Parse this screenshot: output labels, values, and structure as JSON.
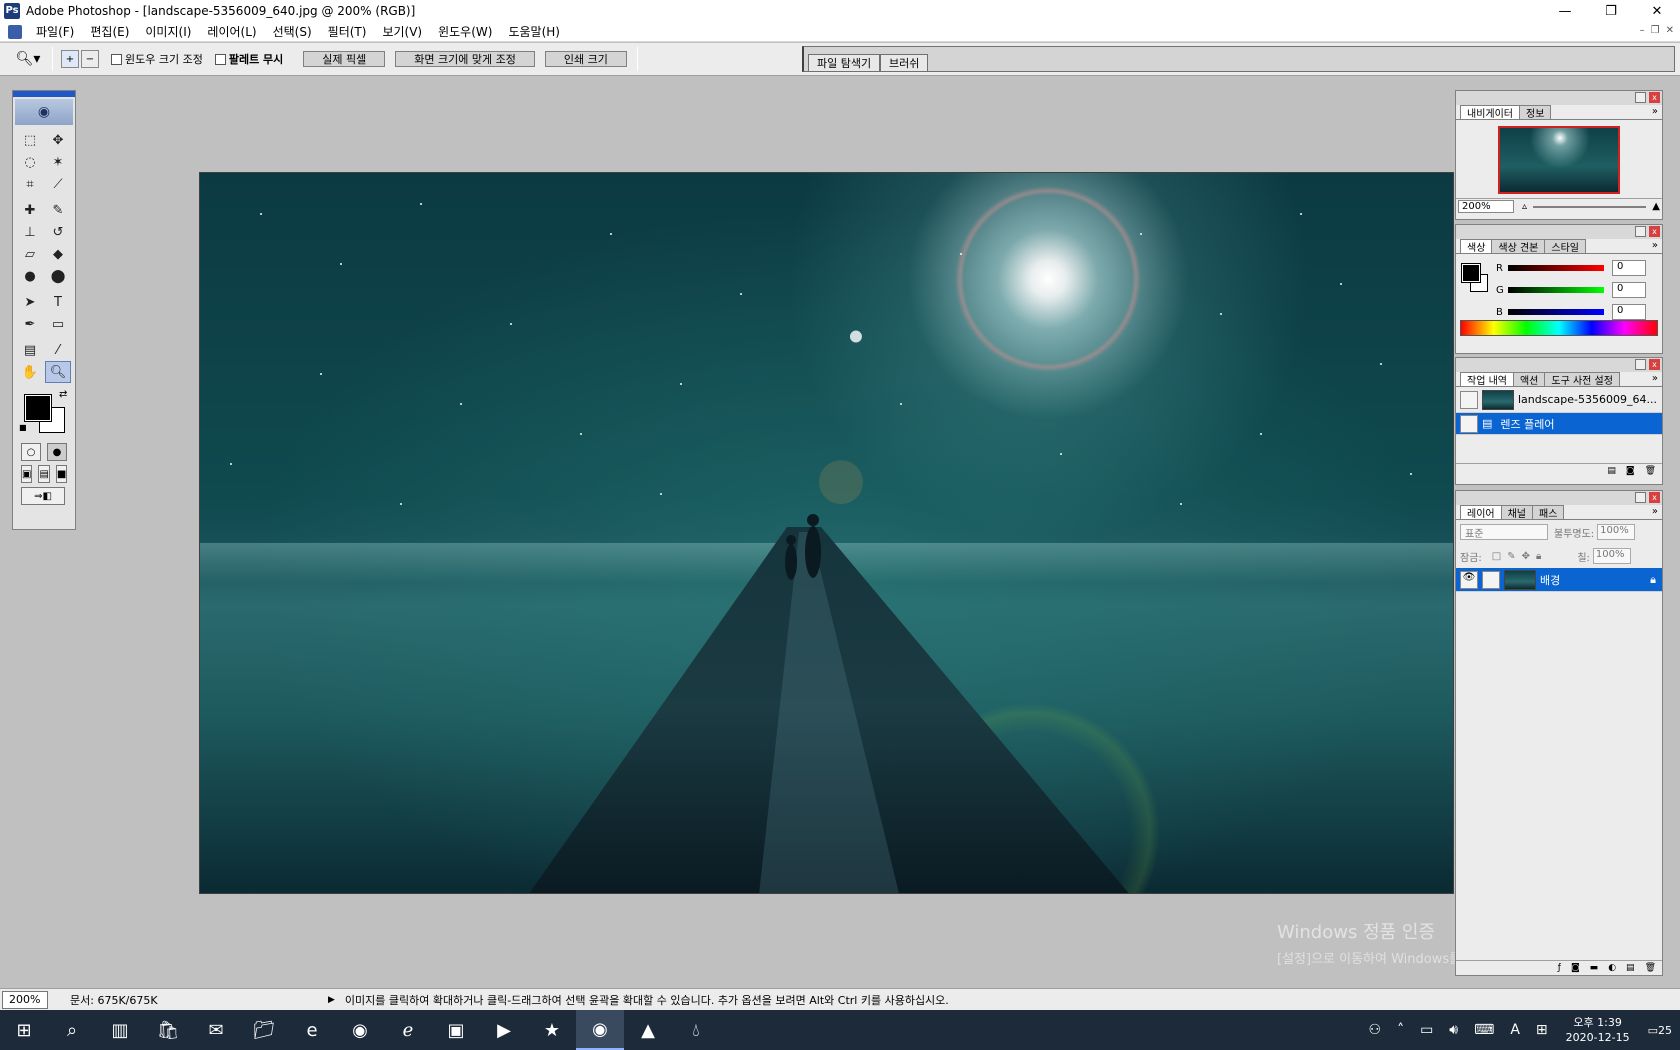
{
  "window": {
    "title": "Adobe Photoshop - [landscape-5356009_640.jpg @ 200% (RGB)]",
    "app_icon": "photoshop-icon",
    "min": "—",
    "max": "❐",
    "close": "✕"
  },
  "menu": [
    "파일(F)",
    "편집(E)",
    "이미지(I)",
    "레이어(L)",
    "선택(S)",
    "필터(T)",
    "보기(V)",
    "윈도우(W)",
    "도움말(H)"
  ],
  "options": {
    "resize_window": "윈도우 크기 조정",
    "ignore_palettes": "팔레트 무시",
    "actual_pixels": "실제 픽셀",
    "fit_on_screen": "화면 크기에 맞게 조정",
    "print_size": "인쇄 크기",
    "well_tabs": [
      "파일 탐색기",
      "브러쉬"
    ]
  },
  "navigator": {
    "tabs": [
      "내비게이터",
      "정보"
    ],
    "zoom": "200%"
  },
  "color_palette": {
    "tabs": [
      "색상",
      "색상 견본",
      "스타일"
    ],
    "r_label": "R",
    "g_label": "G",
    "b_label": "B",
    "r": "0",
    "g": "0",
    "b": "0"
  },
  "history": {
    "tabs": [
      "작업 내역",
      "액션",
      "도구 사전 설정"
    ],
    "snapshot": "landscape-5356009_64...",
    "step": "렌즈 플레어"
  },
  "layers": {
    "tabs": [
      "레이어",
      "채널",
      "패스"
    ],
    "blend_mode": "표준",
    "opacity_label": "불투명도:",
    "opacity": "100%",
    "lock_label": "잠금:",
    "fill_label": "칠:",
    "fill": "100%",
    "layer_name": "배경"
  },
  "watermark": {
    "line1": "Windows 정품 인증",
    "line2": "[설정]으로 이동하여 Windows를 정품 인증합니다."
  },
  "status": {
    "zoom": "200%",
    "doc": "문서: 675K/675K",
    "hint": "이미지를 클릭하여 확대하거나 클릭-드래그하여 선택 윤곽을 확대할 수 있습니다.  추가 옵션을 보려면 Alt와 Ctrl 키를 사용하십시오."
  },
  "taskbar": {
    "time": "오후 1:39",
    "date": "2020-12-15",
    "ime": "A",
    "notifications": "25"
  }
}
